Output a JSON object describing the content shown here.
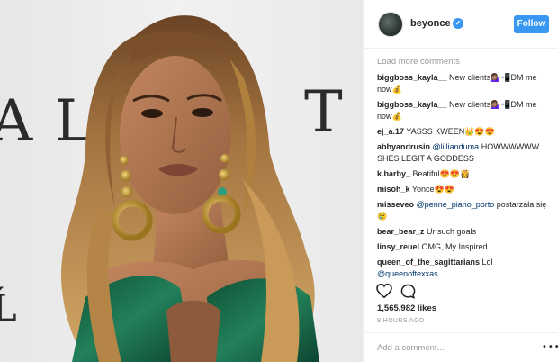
{
  "post": {
    "username": "beyonce",
    "verified_symbol": "✔",
    "follow_label": "Follow",
    "background_letters": [
      "A L",
      "T",
      "Ĺ"
    ]
  },
  "comments": {
    "load_more": "Load more comments",
    "items": [
      {
        "user": "biggboss_kayla__",
        "text": " New clients💁🏽‍♀️📲DM me now💰"
      },
      {
        "user": "biggboss_kayla__",
        "text": " New clients💁🏽‍♀️📲DM me now💰"
      },
      {
        "user": "ej_a.17",
        "text": " YASSS KWEEN👑😍😍"
      },
      {
        "user": "abbyandrusin",
        "mention": "@lillianduma",
        "text": " HOWWWWWW SHES LEGIT A GODDESS"
      },
      {
        "user": "k.barby_",
        "text": " Beatiful😍😍👸"
      },
      {
        "user": "misoh_k",
        "text": " Yonce😍😍"
      },
      {
        "user": "misseveo",
        "mention": "@penne_piano_porto",
        "text": " postarzała się 😢"
      },
      {
        "user": "bear_bear_z",
        "text": " Ur such goals"
      },
      {
        "user": "linsy_reuel",
        "text": " OMG, My Inspired"
      },
      {
        "user": "queen_of_the_sagittarians",
        "text": " Lol ",
        "mention2": "@queenoftexxas"
      }
    ]
  },
  "actions": {
    "likes": "1,565,982 likes",
    "time": "9 HOURS AGO"
  },
  "add_comment": {
    "placeholder": "Add a comment...",
    "more_symbol": "•••"
  },
  "colors": {
    "accent": "#3897f0",
    "dress": "#1e6b4a",
    "hair": "#b98a4f",
    "skin": "#a86f4f"
  }
}
